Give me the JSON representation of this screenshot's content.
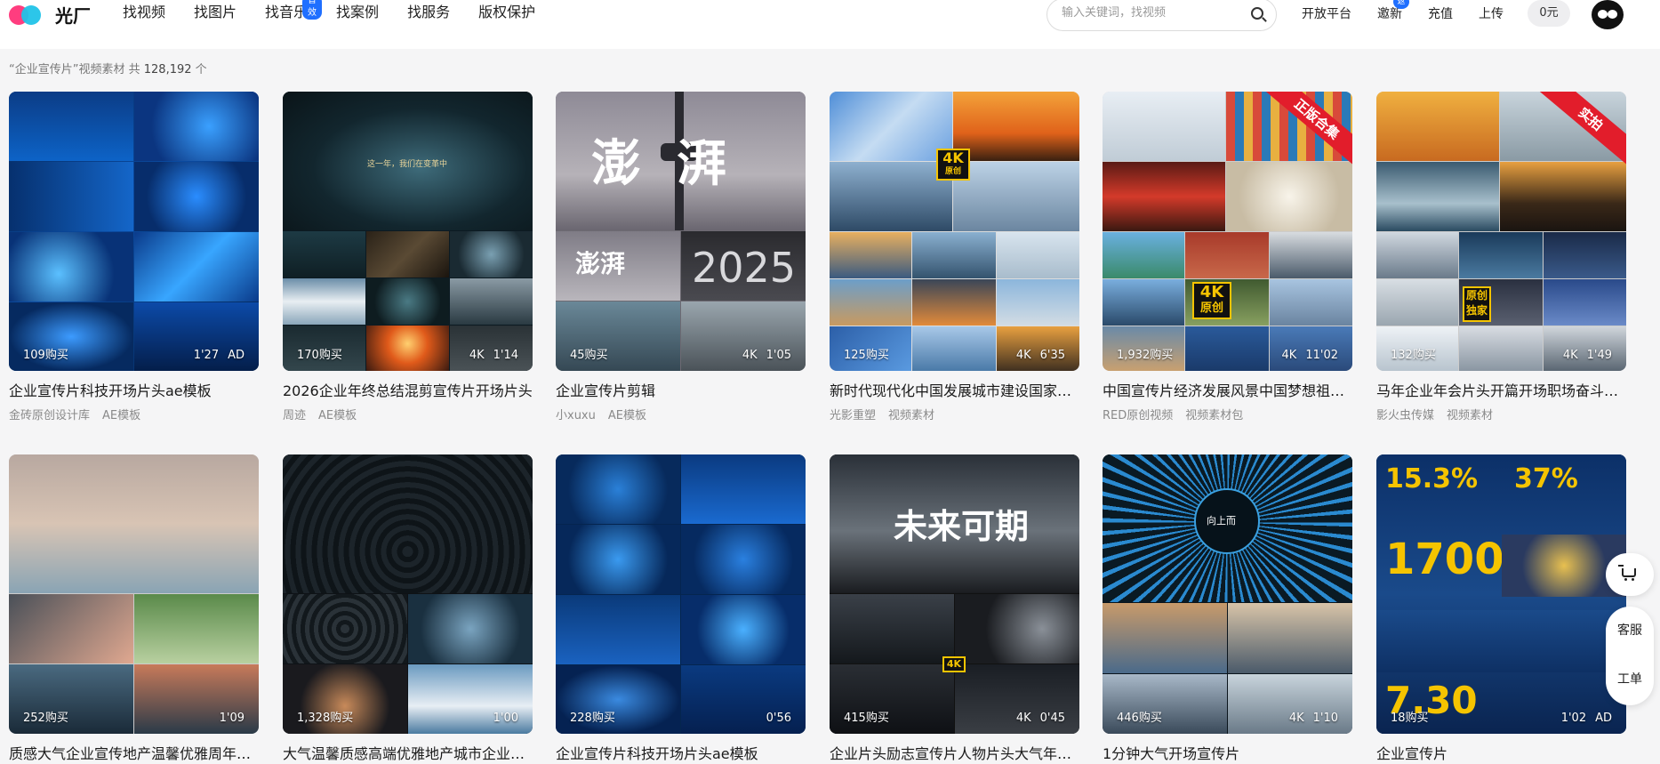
{
  "header": {
    "logo_text": "光厂",
    "nav": [
      {
        "label": "找视频"
      },
      {
        "label": "找图片"
      },
      {
        "label": "找音乐",
        "badge": "音效"
      },
      {
        "label": "找案例"
      },
      {
        "label": "找服务"
      },
      {
        "label": "版权保护"
      }
    ],
    "search_placeholder": "输入关键词，找视频",
    "links": {
      "open_platform": "开放平台",
      "invite": "邀新",
      "invite_badge": "返",
      "recharge": "充值",
      "upload": "上传"
    },
    "balance": "0元"
  },
  "result": {
    "query": "“企业宣传片”视频素材",
    "prefix": " 共 ",
    "count": "128,192",
    "suffix": " 个"
  },
  "cards": [
    {
      "buys": "109购买",
      "duration": "1'27",
      "extra": "AD",
      "title": "企业宣传片科技开场片头ae模板",
      "author": "金砖原创设计库",
      "category": "AE模板"
    },
    {
      "buys": "170购买",
      "quality": "4K",
      "duration": "1'14",
      "title": "2026企业年终总结混剪宣传片开场片头",
      "author": "周迹",
      "category": "AE模板"
    },
    {
      "buys": "45购买",
      "quality": "4K",
      "duration": "1'05",
      "title": "企业宣传片剪辑",
      "author": "小xuxu",
      "category": "AE模板"
    },
    {
      "buys": "125购买",
      "quality": "4K",
      "duration": "6'35",
      "title": "新时代现代化中国发展城市建设国家…",
      "author": "光影重塑",
      "category": "视频素材"
    },
    {
      "buys": "1,932购买",
      "quality": "4K",
      "duration": "11'02",
      "title": "中国宣传片经济发展风景中国梦想祖…",
      "author": "RED原创视频",
      "category": "视频素材包"
    },
    {
      "buys": "132购买",
      "quality": "4K",
      "duration": "1'49",
      "title": "马年企业年会片头开篇开场职场奋斗…",
      "author": "影火虫传媒",
      "category": "视频素材"
    },
    {
      "buys": "252购买",
      "duration": "1'09",
      "title": "质感大气企业宣传地产温馨优雅周年…",
      "author": "",
      "category": ""
    },
    {
      "buys": "1,328购买",
      "duration": "1'00",
      "title": "大气温馨质感高端优雅地产城市企业…",
      "author": "",
      "category": ""
    },
    {
      "buys": "228购买",
      "duration": "0'56",
      "title": "企业宣传片科技开场片头ae模板",
      "author": "",
      "category": ""
    },
    {
      "buys": "415购买",
      "quality": "4K",
      "duration": "0'45",
      "title": "企业片头励志宣传片人物片头大气年…",
      "author": "",
      "category": ""
    },
    {
      "buys": "446购买",
      "quality": "4K",
      "duration": "1'10",
      "title": "1分钟大气开场宣传片",
      "author": "",
      "category": ""
    },
    {
      "buys": "18购买",
      "duration": "1'02",
      "extra": "AD",
      "title": "企业宣传片",
      "author": "",
      "category": ""
    }
  ],
  "overlays": {
    "c3_big": "澎湃",
    "c3_small": "澎湃",
    "c3_year": "2025",
    "tag_4k": "4K",
    "tag_4k_sub": "原创",
    "c5_ribbon": "正版合集",
    "c6_ribbon": "实拍",
    "c6_tag": "原创独家",
    "c10_text": "未来可期",
    "c12_big": "1700",
    "c12_top": "15.3%",
    "c12_top2": "37%",
    "c12_bottom": "7.30",
    "c2_caption": "这一年，我们在变革中",
    "c11_ring": "向上而"
  },
  "float": {
    "service": "客服",
    "ticket": "工单"
  },
  "colors": {
    "accent": "#1f6fff",
    "brand_pink": "#ff3d7f",
    "brand_cyan": "#21c3e8",
    "ribbon_red": "#e21d2b"
  }
}
